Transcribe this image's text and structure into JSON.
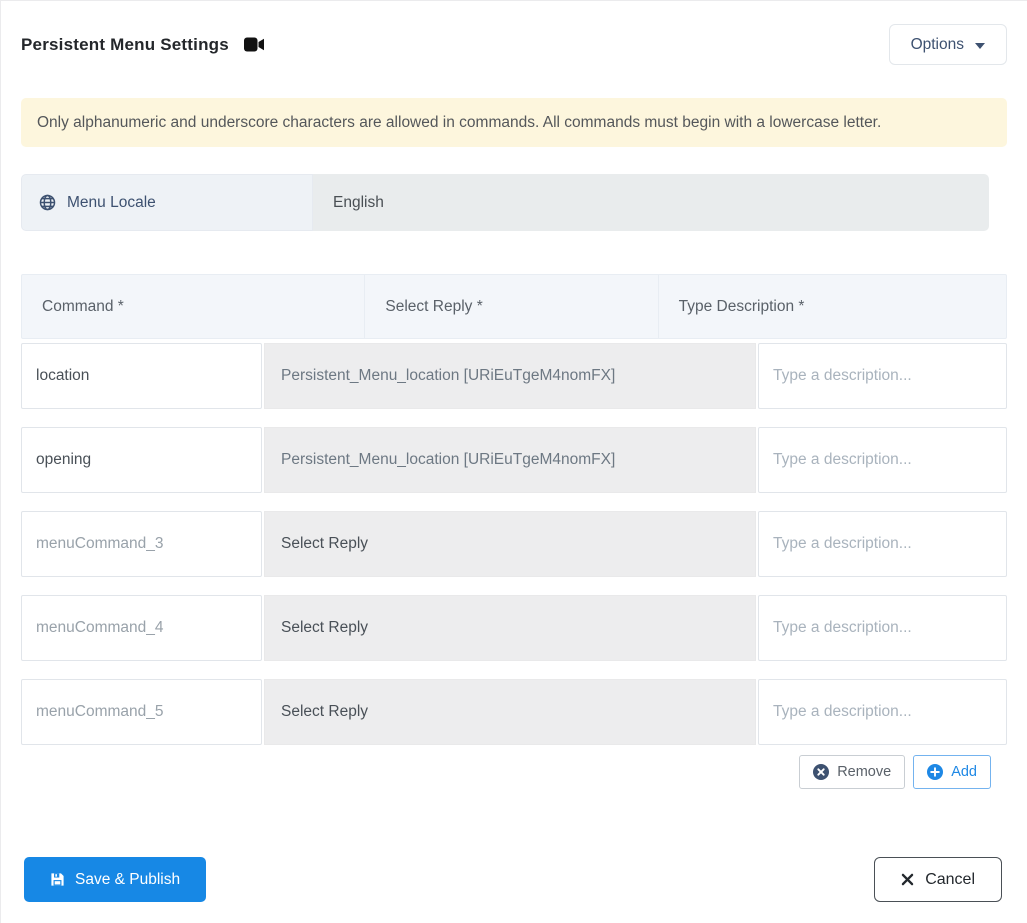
{
  "header": {
    "title": "Persistent Menu Settings",
    "options_label": "Options"
  },
  "banner": {
    "text": "Only alphanumeric and underscore characters are allowed in commands. All commands must begin with a lowercase letter."
  },
  "locale": {
    "label": "Menu Locale",
    "value": "English"
  },
  "table": {
    "headers": [
      "Command *",
      "Select Reply *",
      "Type Description *"
    ],
    "rows": [
      {
        "command": "location",
        "reply": "Persistent_Menu_location [URiEuTgeM4nomFX]",
        "reply_selected": true,
        "description_placeholder": "Type a description..."
      },
      {
        "command": "opening",
        "reply": "Persistent_Menu_location [URiEuTgeM4nomFX]",
        "reply_selected": true,
        "description_placeholder": "Type a description..."
      },
      {
        "command_placeholder": "menuCommand_3",
        "reply": "Select Reply",
        "reply_selected": false,
        "description_placeholder": "Type a description..."
      },
      {
        "command_placeholder": "menuCommand_4",
        "reply": "Select Reply",
        "reply_selected": false,
        "description_placeholder": "Type a description..."
      },
      {
        "command_placeholder": "menuCommand_5",
        "reply": "Select Reply",
        "reply_selected": false,
        "description_placeholder": "Type a description..."
      }
    ]
  },
  "actions": {
    "remove_label": "Remove",
    "add_label": "Add"
  },
  "footer": {
    "save_label": "Save & Publish",
    "cancel_label": "Cancel"
  },
  "icons": {
    "title_icon": "video-camera-icon",
    "locale_icon": "globe-icon",
    "options_icon": "chevron-down-icon",
    "remove_icon": "circle-x-icon",
    "add_icon": "circle-plus-icon",
    "save_icon": "floppy-disk-icon",
    "cancel_icon": "x-icon"
  },
  "colors": {
    "primary_blue": "#1788e5",
    "accent_blue": "#1e88e5",
    "dark_slate": "#3d5170",
    "banner_bg": "#fdf6dd",
    "header_bg": "#f3f6fa",
    "locale_label_bg": "#eef2f6",
    "disabled_field_bg": "#e9eced",
    "reply_cell_bg": "#ededee"
  }
}
